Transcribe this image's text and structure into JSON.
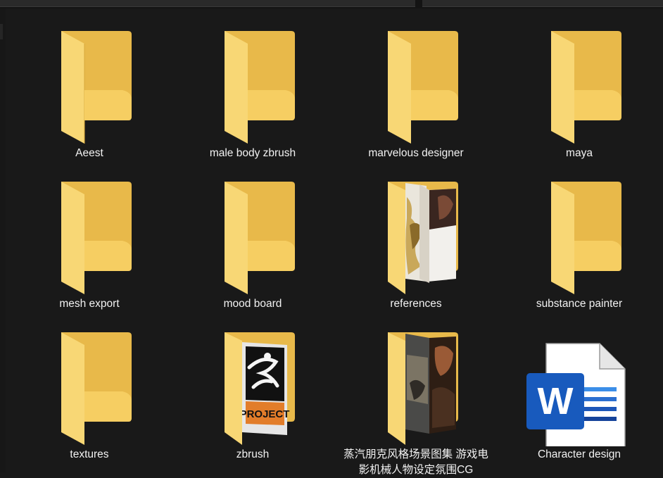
{
  "items": [
    {
      "label": "Aeest",
      "type": "folder"
    },
    {
      "label": "male body zbrush",
      "type": "folder"
    },
    {
      "label": "marvelous designer",
      "type": "folder"
    },
    {
      "label": "maya",
      "type": "folder"
    },
    {
      "label": "mesh export",
      "type": "folder"
    },
    {
      "label": "mood board",
      "type": "folder"
    },
    {
      "label": "references",
      "type": "folder-images"
    },
    {
      "label": "substance painter",
      "type": "folder"
    },
    {
      "label": "textures",
      "type": "folder"
    },
    {
      "label": "zbrush",
      "type": "folder-zbrush"
    },
    {
      "label": "蒸汽朋克风格场景图集 游戏电影机械人物设定氛围CG",
      "type": "folder-images"
    },
    {
      "label": "Character design",
      "type": "word-document"
    }
  ],
  "icons": {
    "folder": "folder-icon",
    "folder_images": "image-folder-icon",
    "zbrush": "zbrush-project-icon",
    "word": "word-document-icon"
  },
  "badges": {
    "zbrush_text": "PROJECT",
    "word_letter": "W"
  },
  "colors": {
    "background": "#191919",
    "folder_front": "#F8D775",
    "folder_back": "#E8B94A",
    "word_blue": "#185ABD",
    "text": "#F2F2F2"
  }
}
